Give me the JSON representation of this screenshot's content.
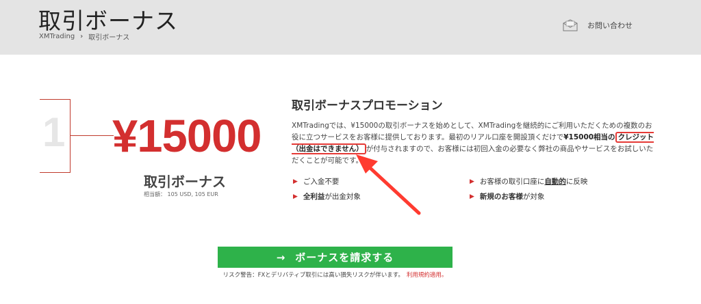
{
  "header": {
    "title": "取引ボーナス",
    "breadcrumb": {
      "home": "XMTrading",
      "current": "取引ボーナス"
    },
    "contact_label": "お問い合わせ"
  },
  "bonus": {
    "step_number": "1",
    "amount": "¥15000",
    "label": "取引ボーナス",
    "equivalent": "相当額： 105 USD, 105 EUR"
  },
  "promo": {
    "title": "取引ボーナスプロモーション",
    "desc_part1": "XMTradingでは、¥15000の取引ボーナスを始めとして、XMTradingを継続的にご利用いただくための複数のお役に立つサービスをお客様に提供しております。最初のリアル口座を開設頂くだけで",
    "desc_bold": "¥15000相当の",
    "desc_highlight": "クレジット（出金はできません）",
    "desc_part2": "が付与されますので、お客様には初回入金の必要なく弊社の商品やサービスをお試しいただくことが可能です。"
  },
  "features": {
    "f1": {
      "text": "ご入金不要"
    },
    "f2": {
      "bold": "全利益",
      "rest": "が出金対象"
    },
    "f3": {
      "pre": "お客様の取引口座に",
      "u": "自動的",
      "post": "に反映"
    },
    "f4": {
      "bold": "新規のお客様",
      "rest": "が対象"
    }
  },
  "cta": {
    "arrow": "→",
    "label": "ボーナスを請求する"
  },
  "risk": {
    "text": "リスク警告：FXとデリバティブ取引には高い損失リスクが伴います。",
    "link": "利用規約適用。"
  },
  "colors": {
    "accent_red": "#d32f2f",
    "cta_green": "#2eb24a",
    "header_bg": "#e4e4e4"
  }
}
